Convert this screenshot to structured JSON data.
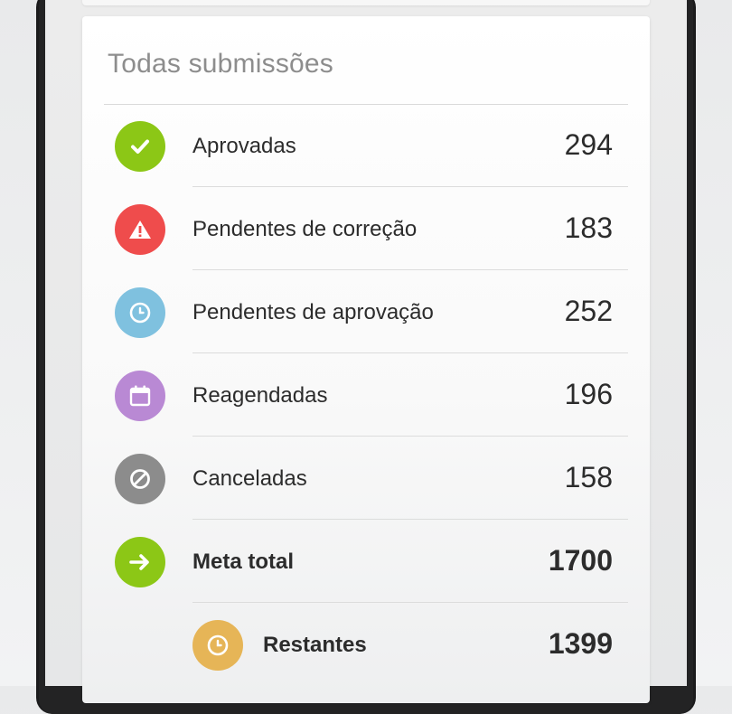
{
  "card": {
    "title": "Todas submissões"
  },
  "rows": [
    {
      "label": "Aprovadas",
      "value": "294",
      "icon": "check-icon",
      "color": "#8cc716"
    },
    {
      "label": "Pendentes de correção",
      "value": "183",
      "icon": "warning-icon",
      "color": "#ef4c4c"
    },
    {
      "label": "Pendentes de aprovação",
      "value": "252",
      "icon": "clock-icon",
      "color": "#7fc1df"
    },
    {
      "label": "Reagendadas",
      "value": "196",
      "icon": "calendar-icon",
      "color": "#b989d4"
    },
    {
      "label": "Canceladas",
      "value": "158",
      "icon": "cancel-icon",
      "color": "#8c8c8c"
    },
    {
      "label": "Meta total",
      "value": "1700",
      "icon": "arrow-right-icon",
      "color": "#8cc716"
    },
    {
      "label": "Restantes",
      "value": "1399",
      "icon": "clock-icon",
      "color": "#e6b557"
    }
  ]
}
